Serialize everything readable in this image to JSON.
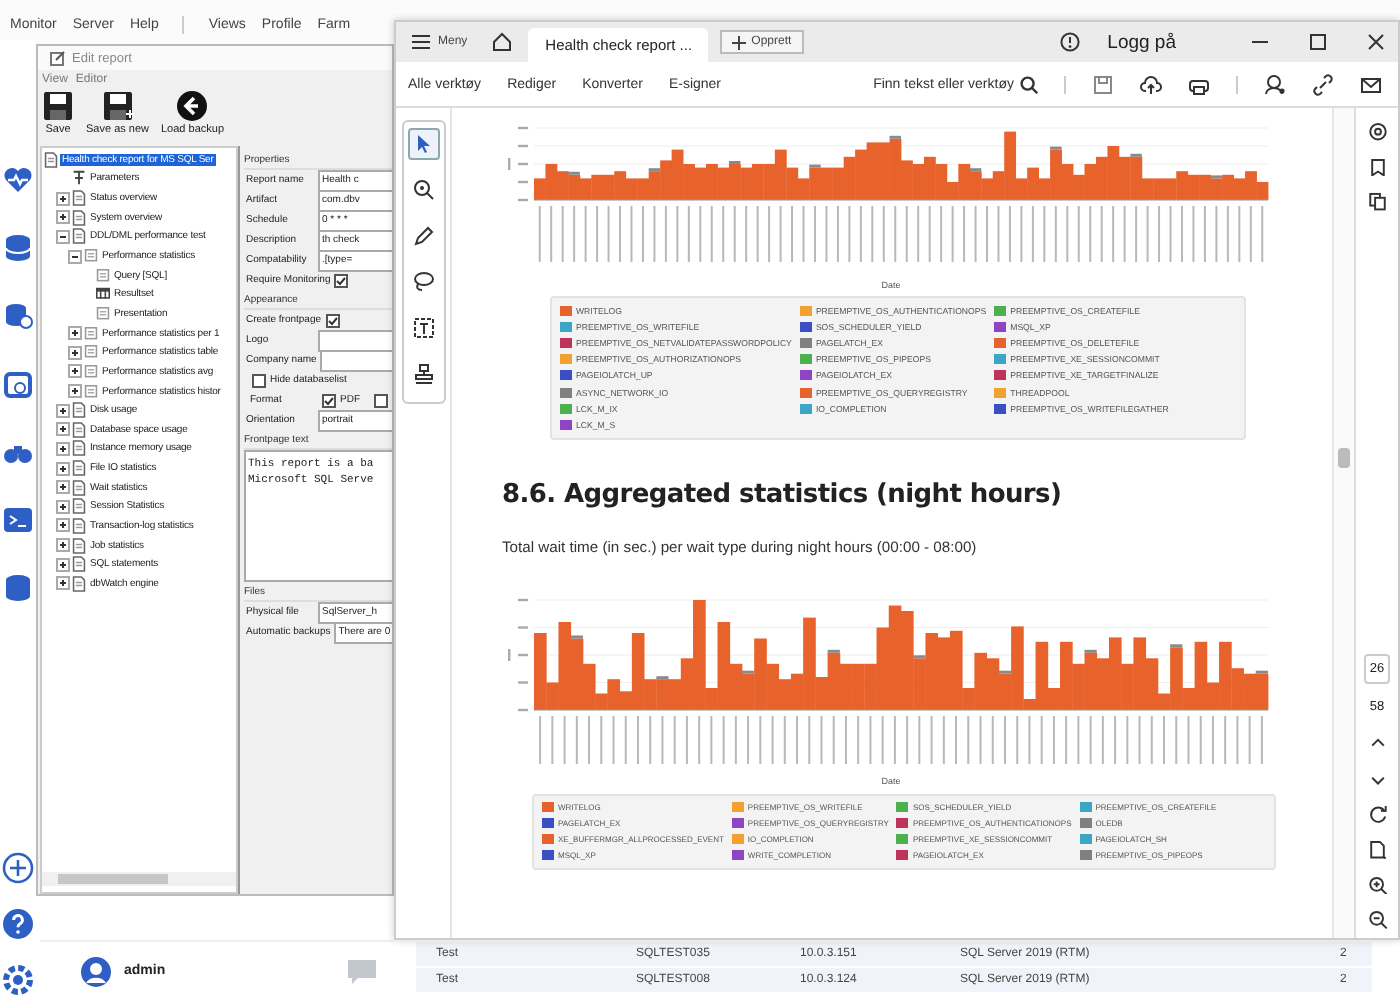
{
  "app": {
    "menu_groups": [
      [
        "Monitor",
        "Server",
        "Help"
      ],
      [
        "Views",
        "Profile",
        "Farm"
      ]
    ],
    "user": "admin"
  },
  "background_table": {
    "rows": [
      {
        "cells": [
          "Test",
          "SQLTEST035",
          "10.0.3.151",
          "SQL Server 2019 (RTM)",
          "2"
        ]
      },
      {
        "cells": [
          "Test",
          "SQLTEST008",
          "10.0.3.124",
          "SQL Server 2019 (RTM)",
          "2"
        ]
      }
    ]
  },
  "editor": {
    "title": "Edit report",
    "menu": [
      "View",
      "Editor"
    ],
    "toolbar": [
      {
        "kind": "save",
        "label": "Save"
      },
      {
        "kind": "save-as",
        "label": "Save as new"
      },
      {
        "kind": "back",
        "label": "Load backup"
      }
    ],
    "tree": [
      {
        "kind": "report",
        "label": "Health check report for MS SQL Ser",
        "selected": true,
        "children": [
          {
            "kind": "param",
            "label": "Parameters",
            "selected": false
          },
          {
            "kind": "page",
            "label": "Status overview",
            "expanded": false,
            "selected": false
          },
          {
            "kind": "page",
            "label": "System overview",
            "expanded": false,
            "selected": false
          },
          {
            "kind": "page",
            "label": "DDL/DML performance test",
            "expanded": true,
            "selected": false,
            "children": [
              {
                "kind": "section",
                "label": "Performance statistics",
                "expanded": true,
                "selected": false,
                "children": [
                  {
                    "kind": "section",
                    "label": "Query [SQL]",
                    "selected": false
                  },
                  {
                    "kind": "table",
                    "label": "Resultset",
                    "selected": false
                  },
                  {
                    "kind": "section",
                    "label": "Presentation",
                    "selected": false
                  }
                ]
              },
              {
                "kind": "section",
                "label": "Performance statistics per 1",
                "expanded": false,
                "selected": false
              },
              {
                "kind": "section",
                "label": "Performance statistics table",
                "expanded": false,
                "selected": false
              },
              {
                "kind": "section",
                "label": "Performance statistics avg",
                "expanded": false,
                "selected": false
              },
              {
                "kind": "section",
                "label": "Performance statistics histor",
                "expanded": false,
                "selected": false
              }
            ]
          },
          {
            "kind": "page",
            "label": "Disk usage",
            "expanded": false,
            "selected": false
          },
          {
            "kind": "page",
            "label": "Database space usage",
            "expanded": false,
            "selected": false
          },
          {
            "kind": "page",
            "label": "Instance memory usage",
            "expanded": false,
            "selected": false
          },
          {
            "kind": "page",
            "label": "File IO statistics",
            "expanded": false,
            "selected": false
          },
          {
            "kind": "page",
            "label": "Wait statistics",
            "expanded": false,
            "selected": false
          },
          {
            "kind": "page",
            "label": "Session Statistics",
            "expanded": false,
            "selected": false
          },
          {
            "kind": "page",
            "label": "Transaction-log statistics",
            "expanded": false,
            "selected": false
          },
          {
            "kind": "page",
            "label": "Job statistics",
            "expanded": false,
            "selected": false
          },
          {
            "kind": "page",
            "label": "SQL statements",
            "expanded": false,
            "selected": false
          },
          {
            "kind": "page",
            "label": "dbWatch engine",
            "expanded": false,
            "selected": false
          }
        ]
      }
    ],
    "properties": [
      {
        "title": "Properties",
        "rows": [
          {
            "kind": "field",
            "label": "Report name",
            "value": "Health c"
          },
          {
            "kind": "field",
            "label": "Artifact",
            "value": "com.dbv"
          },
          {
            "kind": "field",
            "label": "Schedule",
            "value": "0 * * *"
          },
          {
            "kind": "field",
            "label": "Description",
            "value": "th check"
          },
          {
            "kind": "field",
            "label": "Compatability",
            "value": ".[type="
          },
          {
            "kind": "check",
            "label": "Require Monitoring",
            "checked": true
          }
        ]
      },
      {
        "title": "Appearance",
        "rows": [
          {
            "kind": "check",
            "label": "Create frontpage",
            "checked": true
          },
          {
            "kind": "field",
            "label": "Logo"
          },
          {
            "kind": "field",
            "label": "Company name"
          },
          {
            "kind": "checkleft",
            "label": "Hide databaselist",
            "checked": false
          },
          {
            "kind": "checks",
            "label": "Format",
            "options": [
              {
                "label": "PDF",
                "checked": true
              },
              {
                "checked": false
              }
            ]
          },
          {
            "kind": "field",
            "label": "Orientation",
            "value": "portrait"
          }
        ]
      },
      {
        "title": "Frontpage text",
        "rows": [
          {
            "kind": "textarea",
            "value": "This report is a ba\nMicrosoft SQL Serve"
          }
        ]
      },
      {
        "title": "Files",
        "rows": [
          {
            "kind": "field",
            "label": "Physical file",
            "value": "SqlServer_h"
          },
          {
            "kind": "field",
            "label": "Automatic backups",
            "value": "There are 0"
          }
        ]
      }
    ]
  },
  "viewer": {
    "menu_label": "Meny",
    "tab": "Health check report ...",
    "new_button": "Opprett",
    "login": "Logg på",
    "tools": [
      "Alle verktøy",
      "Rediger",
      "Konverter",
      "E-signer"
    ],
    "search_placeholder": "Finn tekst eller verktøy",
    "left_tools": [
      {
        "kind": "select",
        "selected": true
      },
      {
        "kind": "zoom",
        "selected": false
      },
      {
        "kind": "pen",
        "selected": false
      },
      {
        "kind": "lasso",
        "selected": false
      },
      {
        "kind": "text",
        "selected": false
      },
      {
        "kind": "stamp",
        "selected": false
      }
    ],
    "page_current": "26",
    "page_total": "58"
  },
  "document": {
    "top_chart": {
      "xlabel": "Date",
      "legend": [
        {
          "label": "WRITELOG",
          "color": "#e8622c"
        },
        {
          "label": "PREEMPTIVE_OS_AUTHENTICATIONOPS",
          "color": "#f2a12e"
        },
        {
          "label": "PREEMPTIVE_OS_CREATEFILE",
          "color": "#4caf50"
        },
        {
          "label": "PREEMPTIVE_OS_WRITEFILE",
          "color": "#3ba7c4"
        },
        {
          "label": "SOS_SCHEDULER_YIELD",
          "color": "#3b4fc4"
        },
        {
          "label": "MSQL_XP",
          "color": "#8e44c4"
        },
        {
          "label": "PREEMPTIVE_OS_NETVALIDATEPASSWORDPOLICY",
          "color": "#c0335a"
        },
        {
          "label": "PAGELATCH_EX",
          "color": "#808080"
        },
        {
          "label": "PREEMPTIVE_OS_DELETEFILE",
          "color": "#e8622c"
        },
        {
          "label": "PREEMPTIVE_OS_AUTHORIZATIONOPS",
          "color": "#f2a12e"
        },
        {
          "label": "PREEMPTIVE_OS_PIPEOPS",
          "color": "#4caf50"
        },
        {
          "label": "PREEMPTIVE_XE_SESSIONCOMMIT",
          "color": "#3ba7c4"
        },
        {
          "label": "PAGEIOLATCH_UP",
          "color": "#3b4fc4"
        },
        {
          "label": "PAGEIOLATCH_EX",
          "color": "#8e44c4"
        },
        {
          "label": "PREEMPTIVE_XE_TARGETFINALIZE",
          "color": "#c0335a"
        },
        {
          "label": "ASYNC_NETWORK_IO",
          "color": "#808080"
        },
        {
          "label": "PREEMPTIVE_OS_QUERYREGISTRY",
          "color": "#e8622c"
        },
        {
          "label": "THREADPOOL",
          "color": "#f2a12e"
        },
        {
          "label": "LCK_M_IX",
          "color": "#4caf50"
        },
        {
          "label": "IO_COMPLETION",
          "color": "#3ba7c4"
        },
        {
          "label": "PREEMPTIVE_OS_WRITEFILEGATHER",
          "color": "#3b4fc4"
        },
        {
          "label": "LCK_M_S",
          "color": "#8e44c4"
        }
      ]
    },
    "heading": "8.6. Aggregated statistics (night hours)",
    "subtitle": "Total wait time (in sec.) per wait type during night hours (00:00 - 08:00)",
    "bottom_chart": {
      "xlabel": "Date",
      "legend": [
        {
          "label": "WRITELOG",
          "color": "#e8622c"
        },
        {
          "label": "PREEMPTIVE_OS_WRITEFILE",
          "color": "#f2a12e"
        },
        {
          "label": "SOS_SCHEDULER_YIELD",
          "color": "#4caf50"
        },
        {
          "label": "PREEMPTIVE_OS_CREATEFILE",
          "color": "#3ba7c4"
        },
        {
          "label": "PAGELATCH_EX",
          "color": "#3b4fc4"
        },
        {
          "label": "PREEMPTIVE_OS_QUERYREGISTRY",
          "color": "#8e44c4"
        },
        {
          "label": "PREEMPTIVE_OS_AUTHENTICATIONOPS",
          "color": "#c0335a"
        },
        {
          "label": "OLEDB",
          "color": "#808080"
        },
        {
          "label": "XE_BUFFERMGR_ALLPROCESSED_EVENT",
          "color": "#e8622c"
        },
        {
          "label": "IO_COMPLETION",
          "color": "#f2a12e"
        },
        {
          "label": "PREEMPTIVE_XE_SESSIONCOMMIT",
          "color": "#4caf50"
        },
        {
          "label": "PAGEIOLATCH_SH",
          "color": "#3ba7c4"
        },
        {
          "label": "MSQL_XP",
          "color": "#3b4fc4"
        },
        {
          "label": "WRITE_COMPLETION",
          "color": "#8e44c4"
        },
        {
          "label": "PAGEIOLATCH_EX",
          "color": "#c0335a"
        },
        {
          "label": "PREEMPTIVE_OS_PIPEOPS",
          "color": "#808080"
        }
      ]
    }
  }
}
